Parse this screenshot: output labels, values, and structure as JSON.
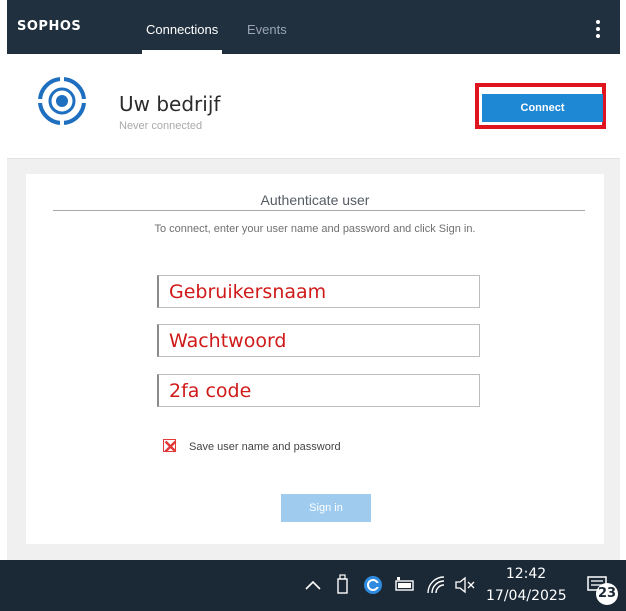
{
  "app": {
    "logo_text": "SOPHOS",
    "tabs": [
      {
        "label": "Connections",
        "active": true
      },
      {
        "label": "Events",
        "active": false
      }
    ],
    "menu_icon": "kebab-menu-icon"
  },
  "connection": {
    "name": "Uw bedrijf",
    "status": "Never connected",
    "connect_label": "Connect",
    "icon": "connection-target-icon"
  },
  "auth": {
    "title": "Authenticate user",
    "instructions": "To connect, enter your user name and password and click Sign in.",
    "username_placeholder": "Gebruikersnaam",
    "password_placeholder": "Wachtwoord",
    "twofa_placeholder": "2fa code",
    "save_label": "Save user name and password",
    "save_checked": false,
    "signin_label": "Sign in"
  },
  "taskbar": {
    "time": "12:42",
    "date": "17/04/2025",
    "notification_count": "23",
    "tray_icons": [
      "chevron-up-icon",
      "usb-drive-icon",
      "sophos-tray-icon",
      "battery-icon",
      "wifi-icon",
      "volume-muted-icon",
      "notification-icon"
    ]
  },
  "colors": {
    "nav_bg": "#21303e",
    "accent": "#1e88d4",
    "highlight": "#e0141e",
    "annotation_text": "#d01a1a",
    "taskbar_bg": "#1b2836"
  }
}
